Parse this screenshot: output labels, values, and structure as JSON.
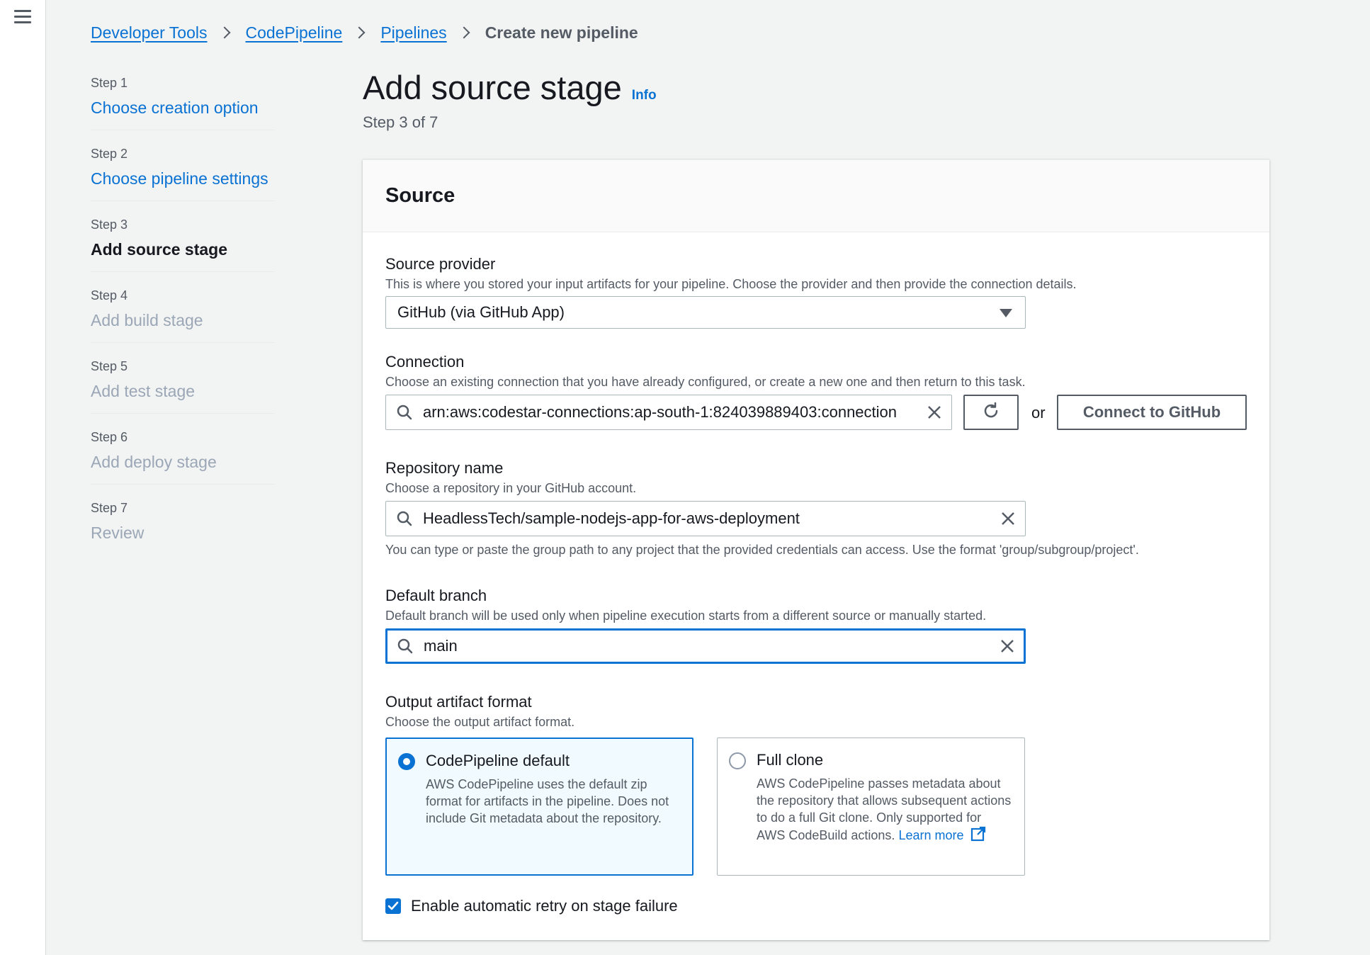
{
  "breadcrumb": {
    "items": [
      "Developer Tools",
      "CodePipeline",
      "Pipelines"
    ],
    "current": "Create new pipeline"
  },
  "steps": [
    {
      "num": "Step 1",
      "title": "Choose creation option",
      "state": "link"
    },
    {
      "num": "Step 2",
      "title": "Choose pipeline settings",
      "state": "link"
    },
    {
      "num": "Step 3",
      "title": "Add source stage",
      "state": "current"
    },
    {
      "num": "Step 4",
      "title": "Add build stage",
      "state": "disabled"
    },
    {
      "num": "Step 5",
      "title": "Add test stage",
      "state": "disabled"
    },
    {
      "num": "Step 6",
      "title": "Add deploy stage",
      "state": "disabled"
    },
    {
      "num": "Step 7",
      "title": "Review",
      "state": "disabled"
    }
  ],
  "page": {
    "title": "Add source stage",
    "info": "Info",
    "step_of": "Step 3 of 7"
  },
  "panel": {
    "title": "Source",
    "source_provider": {
      "label": "Source provider",
      "description": "This is where you stored your input artifacts for your pipeline. Choose the provider and then provide the connection details.",
      "value": "GitHub (via GitHub App)"
    },
    "connection": {
      "label": "Connection",
      "description": "Choose an existing connection that you have already configured, or create a new one and then return to this task.",
      "value": "arn:aws:codestar-connections:ap-south-1:824039889403:connection",
      "or": "or",
      "connect_button": "Connect to GitHub"
    },
    "repository": {
      "label": "Repository name",
      "description": "Choose a repository in your GitHub account.",
      "value": "HeadlessTech/sample-nodejs-app-for-aws-deployment",
      "hint": "You can type or paste the group path to any project that the provided credentials can access. Use the format 'group/subgroup/project'."
    },
    "branch": {
      "label": "Default branch",
      "description": "Default branch will be used only when pipeline execution starts from a different source or manually started.",
      "value": "main"
    },
    "artifact": {
      "label": "Output artifact format",
      "description": "Choose the output artifact format.",
      "options": [
        {
          "title": "CodePipeline default",
          "description": "AWS CodePipeline uses the default zip format for artifacts in the pipeline. Does not include Git metadata about the repository.",
          "selected": true
        },
        {
          "title": "Full clone",
          "description": "AWS CodePipeline passes metadata about the repository that allows subsequent actions to do a full Git clone. Only supported for AWS CodeBuild actions.",
          "link": "Learn more",
          "selected": false
        }
      ]
    },
    "retry": {
      "label": "Enable automatic retry on stage failure",
      "checked": true
    }
  },
  "colors": {
    "accent": "#0972d3",
    "background": "#f2f3f3",
    "disabled": "#9ba7b6"
  }
}
